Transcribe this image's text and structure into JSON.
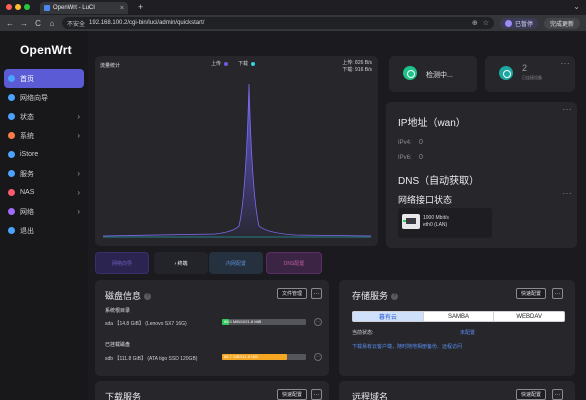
{
  "browser": {
    "tab_title": "OpenWrt - LuCI",
    "tab_close": "×",
    "new_tab": "+",
    "tab_menu": "⌄",
    "back": "←",
    "forward": "→",
    "reload": "C",
    "home": "⌂",
    "insecure_label": "不安全",
    "url": "192.168.100.2/cgi-bin/luci/admin/quickstart/",
    "paused_label": "已暂停",
    "reinstall_label": "完成更新"
  },
  "sidebar": {
    "logo": "OpenWrt",
    "items": [
      {
        "label": "首页",
        "active": true,
        "icon": "home-icon",
        "color": "#4aa3ff",
        "arrow": ""
      },
      {
        "label": "网络向导",
        "active": false,
        "icon": "wizard-icon",
        "color": "#4aa3ff",
        "arrow": ""
      },
      {
        "label": "状态",
        "active": false,
        "icon": "status-icon",
        "color": "#4aa3ff",
        "arrow": "›"
      },
      {
        "label": "系统",
        "active": false,
        "icon": "system-icon",
        "color": "#ff7a45",
        "arrow": "›"
      },
      {
        "label": "iStore",
        "active": false,
        "icon": "store-icon",
        "color": "#4aa3ff",
        "arrow": ""
      },
      {
        "label": "服务",
        "active": false,
        "icon": "services-icon",
        "color": "#4aa3ff",
        "arrow": "›"
      },
      {
        "label": "NAS",
        "active": false,
        "icon": "nas-icon",
        "color": "#ff5a6e",
        "arrow": "›"
      },
      {
        "label": "网络",
        "active": false,
        "icon": "network-icon",
        "color": "#a06cff",
        "arrow": "›"
      },
      {
        "label": "退出",
        "active": false,
        "icon": "logout-icon",
        "color": "#4aa3ff",
        "arrow": ""
      }
    ]
  },
  "traffic": {
    "title": "流量统计",
    "legend_up": "上传",
    "legend_down": "下载",
    "up_color": "#6a5ce8",
    "down_color": "#2bd4e6",
    "up_rate": "上传: 826 B/s",
    "down_rate": "下载: 916 B/s"
  },
  "status": {
    "checking": "检测中...",
    "devices_count": "2",
    "devices_label": "已连接设备",
    "more": "···"
  },
  "ip": {
    "title": "IP地址（wan）",
    "ipv4_label": "IPv4:",
    "ipv4_value": "0",
    "ipv6_label": "IPv6:",
    "ipv6_value": "0",
    "dns_title": "DNS（自动获取）"
  },
  "interface": {
    "title": "网络接口状态",
    "speed": "1000 Mbit/s",
    "name": "eth0 (LAN)"
  },
  "quick": {
    "q1": "网络向导",
    "q2": "› 终端",
    "q3": "内网配置",
    "q4": "DNS配置"
  },
  "disk": {
    "title": "磁盘信息",
    "help": "?",
    "manage_btn": "文件管理",
    "more_btn": "···",
    "system_label": "系统根目录",
    "system_disk": "sda 【14.8 GiB】 (Lenovo SX7 16G)",
    "system_bar_text": "86.0 MiB/1021.8 MiB",
    "system_bar_fraction": 0.084,
    "system_bar_color": "#2fc85a",
    "mounted_label": "已挂载磁盘",
    "mounted_disk": "sdb 【111.8 GiB】 (ATA tigo SSD 120GB)",
    "mounted_bar_text": "86.7 GiB/111.8 GiB",
    "mounted_bar_fraction": 0.776,
    "mounted_bar_color": "#f5a623",
    "row_more": "···"
  },
  "storage": {
    "title": "存储服务",
    "help": "?",
    "config_btn": "快速配置",
    "more_btn": "···",
    "tabs": [
      "暮有云",
      "SAMBA",
      "WEBDAV"
    ],
    "state_label": "当前状态:",
    "state_value": "未配置",
    "link": "下载易有云客户端，随时随地相册备份、远程访问"
  },
  "download": {
    "title": "下载服务",
    "config_btn": "快速配置",
    "more_btn": "···"
  },
  "remote": {
    "title": "远程域名",
    "config_btn": "快速配置",
    "more_btn": "···"
  }
}
